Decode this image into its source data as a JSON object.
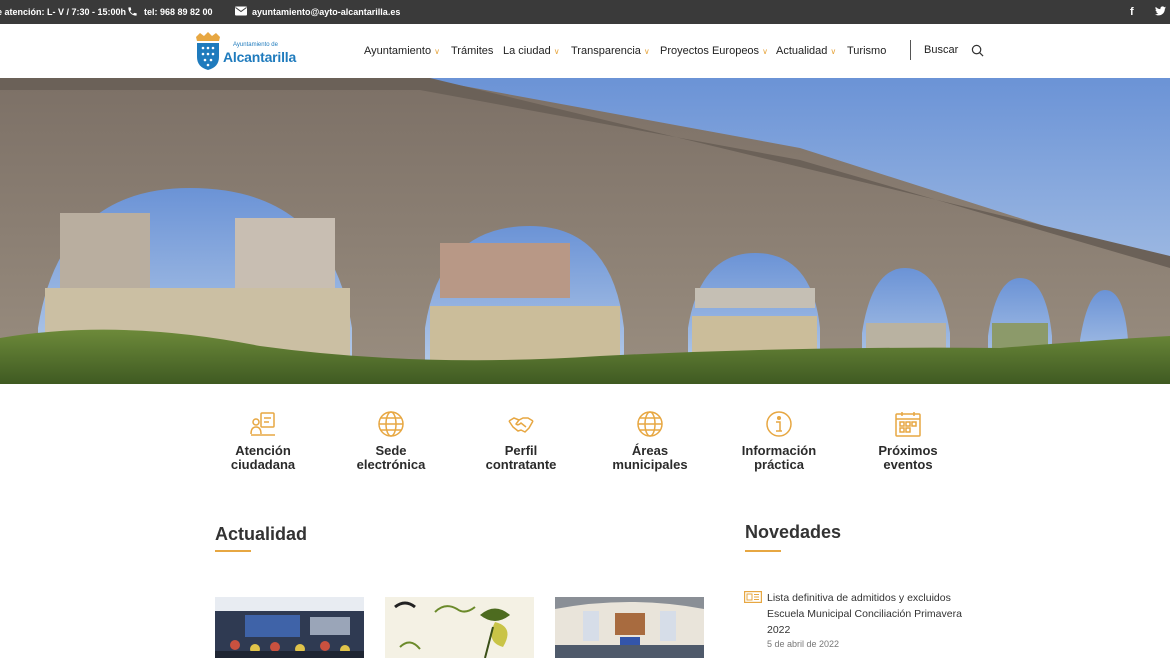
{
  "topbar": {
    "hours": "e atención: L- V / 7:30 - 15:00h",
    "phone": "tel: 968 89 82 00",
    "email": "ayuntamiento@ayto-alcantarilla.es"
  },
  "logo": {
    "small": "Ayuntamiento de",
    "big": "Alcantarilla"
  },
  "nav": {
    "items": [
      {
        "label": "Ayuntamiento",
        "chevron": true
      },
      {
        "label": "Trámites",
        "chevron": false
      },
      {
        "label": "La ciudad",
        "chevron": true
      },
      {
        "label": "Transparencia",
        "chevron": true
      },
      {
        "label": "Proyectos Europeos",
        "chevron": true
      },
      {
        "label": "Actualidad",
        "chevron": true
      },
      {
        "label": "Turismo",
        "chevron": false
      }
    ],
    "search": "Buscar"
  },
  "quick_access": [
    {
      "line1": "Atención",
      "line2": "ciudadana",
      "icon": "citizen-service-icon"
    },
    {
      "line1": "Sede",
      "line2": "electrónica",
      "icon": "globe-icon"
    },
    {
      "line1": "Perfil",
      "line2": "contratante",
      "icon": "handshake-icon"
    },
    {
      "line1": "Áreas",
      "line2": "municipales",
      "icon": "globe-icon"
    },
    {
      "line1": "Información",
      "line2": "práctica",
      "icon": "info-icon"
    },
    {
      "line1": "Próximos",
      "line2": "eventos",
      "icon": "calendar-icon"
    }
  ],
  "actualidad": {
    "title": "Actualidad"
  },
  "novedades": {
    "title": "Novedades",
    "items": [
      {
        "title": "Lista definitiva de admitidos y excluidos Escuela Municipal Conciliación Primavera 2022",
        "date": "5 de abril de 2022"
      }
    ]
  },
  "colors": {
    "accent": "#e7a742",
    "brand": "#1f7bbd",
    "topbar": "#3a3a3a"
  }
}
